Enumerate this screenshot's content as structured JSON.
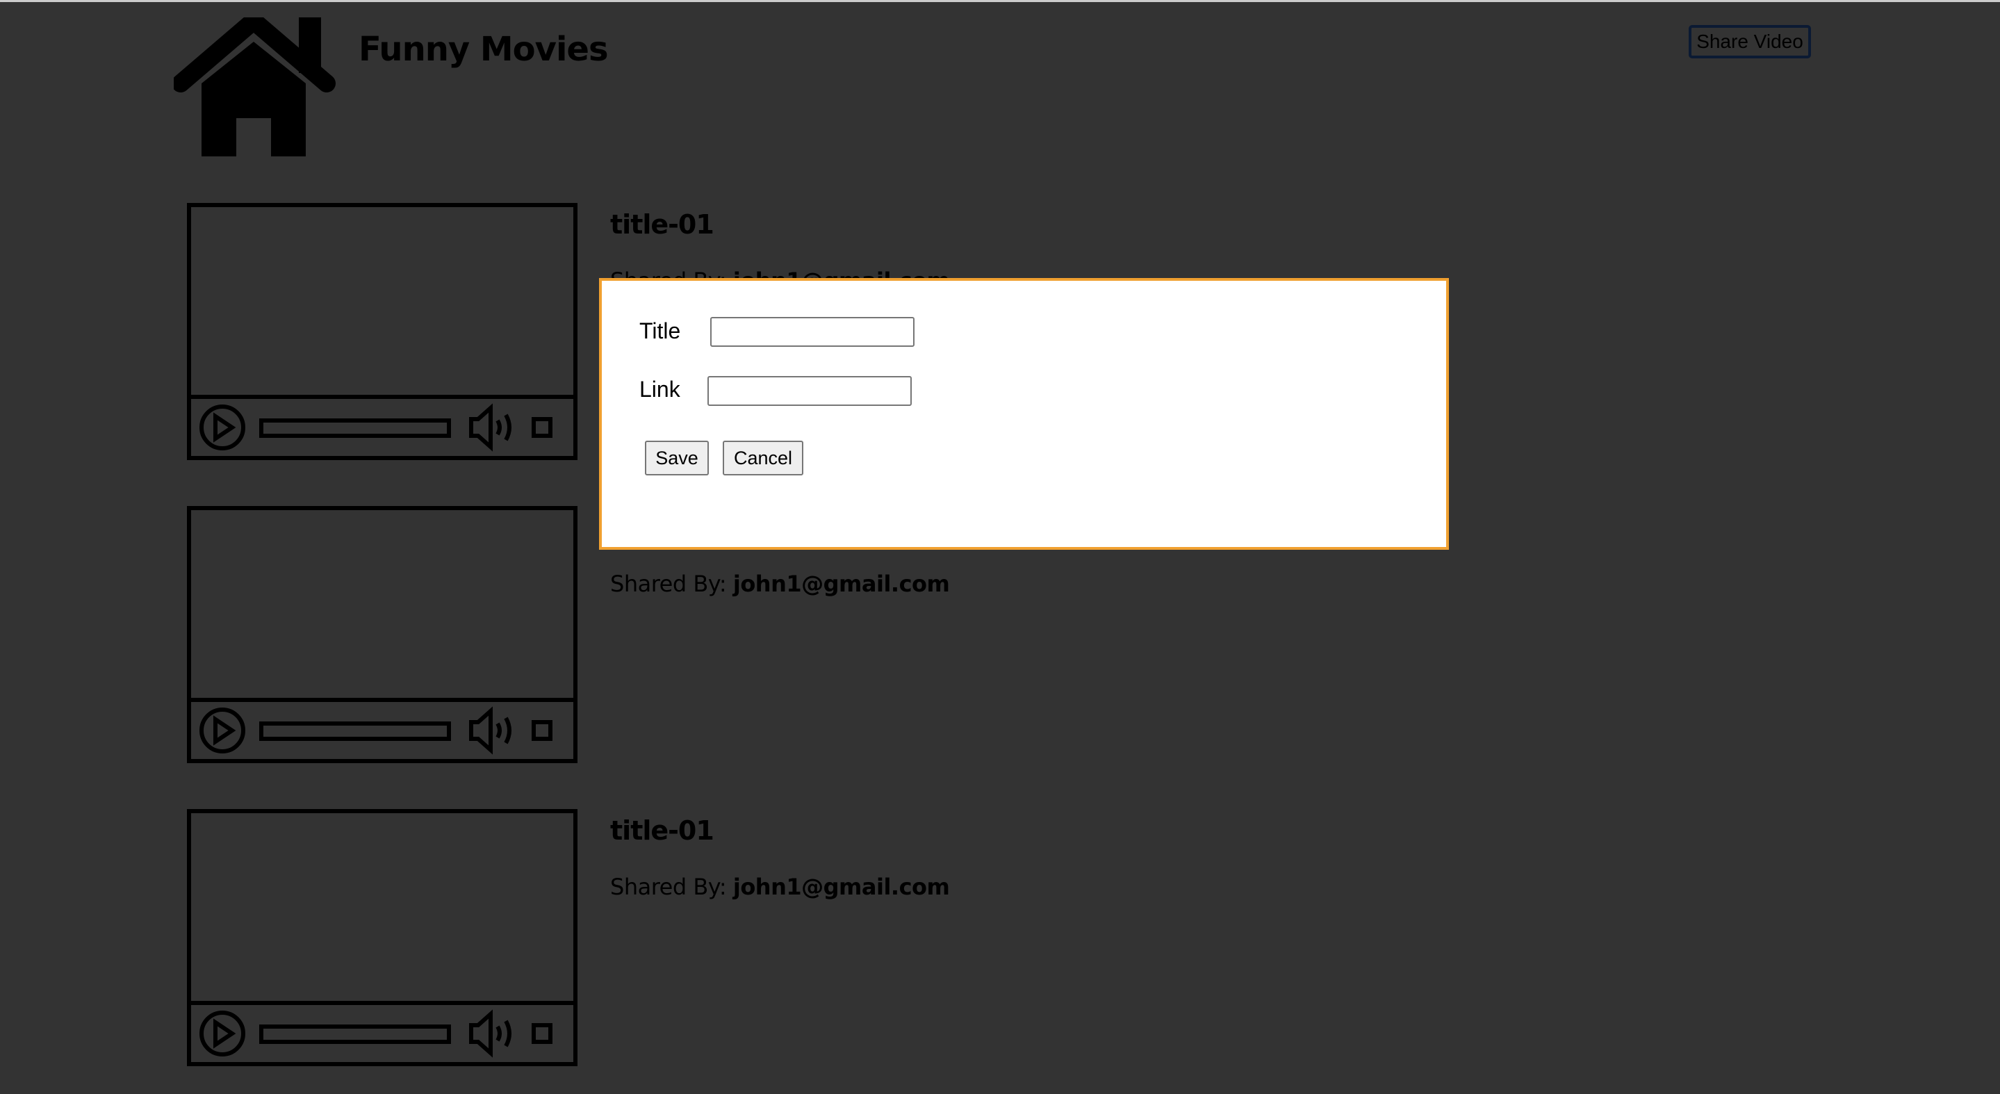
{
  "header": {
    "title": "Funny Movies",
    "share_button": "Share Video"
  },
  "videos": [
    {
      "title": "title-01",
      "shared_by_label": "Shared By:",
      "shared_by": "john1@gmail.com"
    },
    {
      "title": "title-01",
      "shared_by_label": "Shared By:",
      "shared_by": "john1@gmail.com"
    },
    {
      "title": "title-01",
      "shared_by_label": "Shared By:",
      "shared_by": "john1@gmail.com"
    }
  ],
  "modal": {
    "title_label": "Title",
    "title_value": "",
    "link_label": "Link",
    "link_value": "",
    "save": "Save",
    "cancel": "Cancel"
  },
  "colors": {
    "overlay": "#333333",
    "modal_border": "#f0a030"
  }
}
